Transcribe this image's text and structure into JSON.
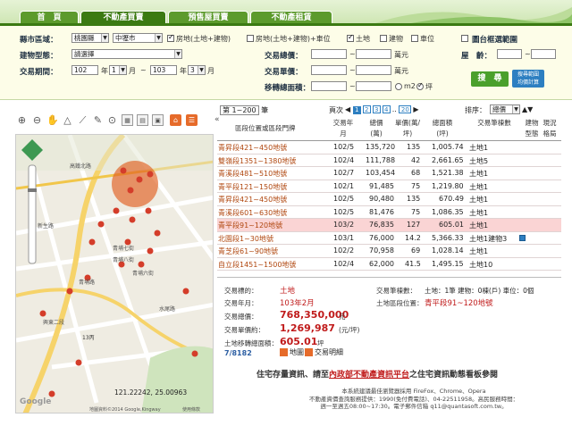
{
  "tabs": [
    "首　頁",
    "不動產買賣",
    "預售屋買賣",
    "不動產租賃"
  ],
  "filter": {
    "county_label": "縣市區域：",
    "county_value": "桃園縣",
    "district_value": "中壢市",
    "types": [
      "房地(土地+建物)",
      "房地(土地+建物)+車位",
      "土地",
      "建物",
      "車位"
    ],
    "map_select_label": "圖台框選範圍",
    "building_type_label": "建物型態：",
    "building_type_value": "請選擇",
    "period_label": "交易期間：",
    "year_from": "102",
    "month_from": "1",
    "year_to": "103",
    "month_to": "3",
    "year_unit": "年",
    "month_unit": "月",
    "total_price_label": "交易總價：",
    "unit_price_label": "交易單價：",
    "area_label": "移轉總面積：",
    "wan": "萬元",
    "tilde": "~",
    "age_label": "屋　齡：",
    "sqm": "m2",
    "ping": "坪",
    "search_btn": "搜　尋",
    "calc_btn_1": "搜尋範圍",
    "calc_btn_2": "均價計算"
  },
  "results": {
    "page_range": "第 1~200",
    "pen_unit": "筆",
    "page_label": "頁次",
    "pages": [
      "1",
      "2",
      "3",
      "4",
      "..",
      "20"
    ],
    "sort_label": "排序：",
    "sort_value": "總價",
    "headers": {
      "location": "區段位置或區段門牌",
      "date": "交易年月",
      "total": "總價(萬)",
      "unit": "單價(萬/坪)",
      "area": "總面積(坪)",
      "count": "交易筆棟數",
      "btype": "建物型態",
      "layout": "現況格局"
    },
    "rows": [
      {
        "name": "青昇段421~450地號",
        "date": "102/5",
        "total": "135,720",
        "unit": "135",
        "area": "1,005.74",
        "count": "土地1"
      },
      {
        "name": "雙嶺段1351~1380地號",
        "date": "102/4",
        "total": "111,788",
        "unit": "42",
        "area": "2,661.65",
        "count": "土地5"
      },
      {
        "name": "青溪段481~510地號",
        "date": "102/7",
        "total": "103,454",
        "unit": "68",
        "area": "1,521.38",
        "count": "土地1"
      },
      {
        "name": "青平段121~150地號",
        "date": "102/1",
        "total": "91,485",
        "unit": "75",
        "area": "1,219.80",
        "count": "土地1"
      },
      {
        "name": "青昇段421~450地號",
        "date": "102/5",
        "total": "90,480",
        "unit": "135",
        "area": "670.49",
        "count": "土地1"
      },
      {
        "name": "青溪段601~630地號",
        "date": "102/5",
        "total": "81,476",
        "unit": "75",
        "area": "1,086.35",
        "count": "土地1"
      },
      {
        "name": "青平段91~120地號",
        "date": "103/2",
        "total": "76,835",
        "unit": "127",
        "area": "605.01",
        "count": "土地1"
      },
      {
        "name": "北園段1~30地號",
        "date": "103/1",
        "total": "76,000",
        "unit": "14.2",
        "area": "5,366.33",
        "count": "土地1建物3"
      },
      {
        "name": "青芝段61~90地號",
        "date": "102/2",
        "total": "70,958",
        "unit": "69",
        "area": "1,028.14",
        "count": "土地1"
      },
      {
        "name": "自立段1451~1500地號",
        "date": "102/4",
        "total": "62,000",
        "unit": "41.5",
        "area": "1,495.15",
        "count": "土地10"
      }
    ]
  },
  "detail": {
    "target_label": "交易標的：",
    "target": "土地",
    "count_label": "交易筆棟數：",
    "count": "土地：1筆 建物：0棟(戶) 車位：0個",
    "date_label": "交易年月：",
    "date": "103年2月",
    "loc_label": "土地區段位置：",
    "loc": "青平段91~120地號",
    "total_label": "交易總價：",
    "total": "768,350,000",
    "total_unit": "元",
    "unit_label": "交易單價約：",
    "unit": "1,269,987",
    "unit_unit": "(元/坪)",
    "area_label": "土地移轉總面積：",
    "area": "605.01",
    "area_unit": "坪",
    "index": "7/8182",
    "map_btn": "地圖",
    "detail_btn": "交易明細"
  },
  "map": {
    "coords": "121.22242, 25.00963",
    "copyright": "地圖資料©2014 Google,Kingway",
    "terms": "使用條款",
    "labels": [
      "青埔七街",
      "青埔八街",
      "青埔六街",
      "青埔路",
      "青溪路",
      "高鐵北路",
      "中山路",
      "高鐵南路",
      "新生路",
      "興東二段",
      "中山路",
      "水尾路",
      "大竹路",
      "青平路",
      "環北路",
      "青峰路"
    ]
  },
  "slogan": {
    "pre": "住宅存量資訊、請至",
    "link": "內政部不動產資訊平台",
    "post": "之住宅資訊動態看板參閱"
  },
  "footer": [
    "本系統建議最佳瀏覽器採用 FireFox、Chrome、Opera",
    "不動產資價查詢服務提供：1990(免付費電話)、04-22511958。高民服務時間：",
    "週一至週五08:00~17:30。電子郵件信箱 q11@quantasoft.com.tw。"
  ]
}
